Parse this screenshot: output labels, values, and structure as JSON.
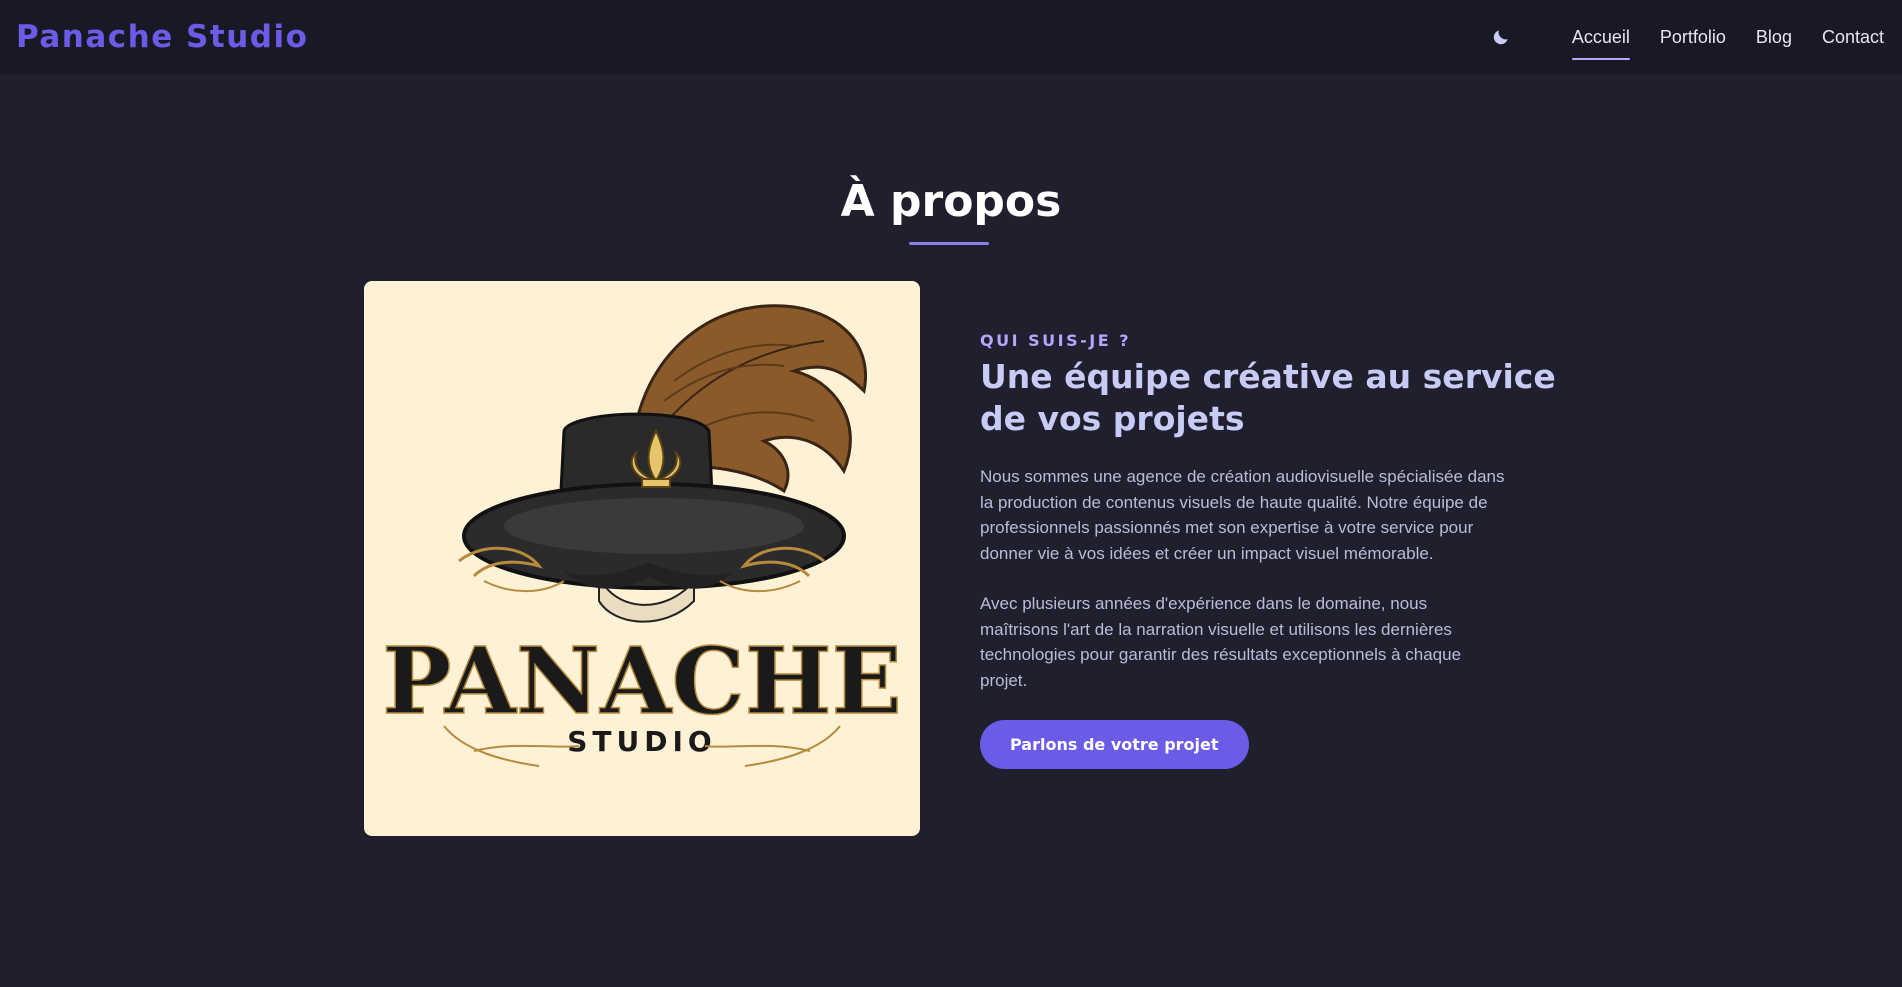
{
  "header": {
    "brand": "Panache Studio",
    "theme_icon": "moon-icon",
    "nav": [
      {
        "label": "Accueil",
        "active": true
      },
      {
        "label": "Portfolio",
        "active": false
      },
      {
        "label": "Blog",
        "active": false
      },
      {
        "label": "Contact",
        "active": false
      }
    ]
  },
  "about": {
    "title": "À propos",
    "kicker": "QUI SUIS-JE ?",
    "heading": "Une équipe créative au service de vos projets",
    "paragraphs": [
      "Nous sommes une agence de création audiovisuelle spécialisée dans la production de contenus visuels de haute qualité. Notre équipe de professionnels passionnés met son expertise à votre service pour donner vie à vos idées et créer un impact visuel mémorable.",
      "Avec plusieurs années d'expérience dans le domaine, nous maîtrisons l'art de la narration visuelle et utilisons les dernières technologies pour garantir des résultats exceptionnels à chaque projet."
    ],
    "cta_label": "Parlons de votre projet",
    "logo": {
      "wordmark": "PANACHE",
      "subtitle": "STUDIO"
    }
  },
  "colors": {
    "background": "#1f1f2e",
    "navbar": "#191926",
    "accent": "#6b5ce7",
    "kicker": "#b9a4ff",
    "heading": "#c8cbf5",
    "logo_background": "#fdf2d6"
  }
}
